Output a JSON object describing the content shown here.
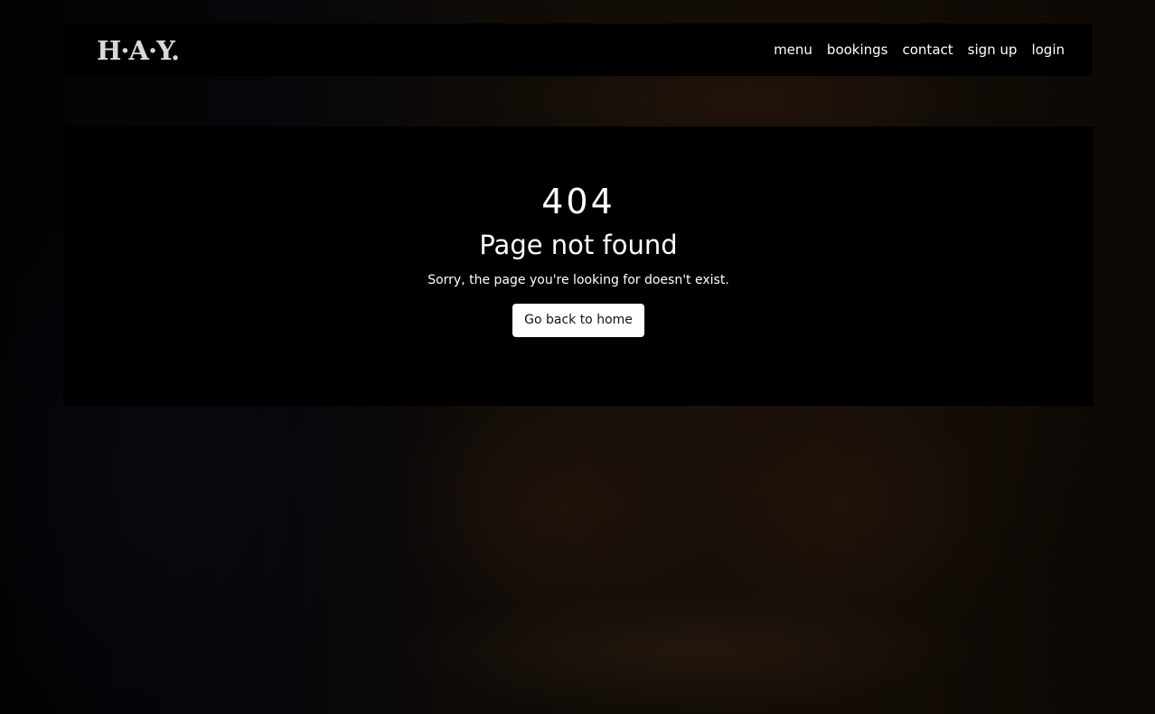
{
  "brand": {
    "logo_text": "H·A·Y."
  },
  "nav": {
    "items": [
      {
        "label": "menu"
      },
      {
        "label": "bookings"
      },
      {
        "label": "contact"
      },
      {
        "label": "sign up"
      },
      {
        "label": "login"
      }
    ]
  },
  "error": {
    "code": "404",
    "title": "Page not found",
    "message": "Sorry, the page you're looking for doesn't exist.",
    "home_button_label": "Go back to home"
  },
  "colors": {
    "panel": "#000000",
    "text": "#ffffff",
    "button_bg": "#ffffff",
    "logo": "#d9d9d9"
  }
}
